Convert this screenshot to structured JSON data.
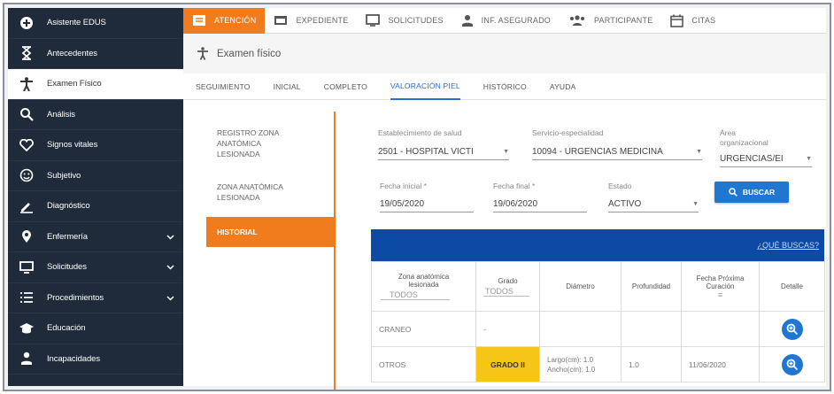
{
  "sidebar": {
    "items": [
      {
        "label": "Asistente EDUS",
        "icon": "plus-circle-icon"
      },
      {
        "label": "Antecedentes",
        "icon": "hourglass-icon"
      },
      {
        "label": "Examen Físico",
        "icon": "person-icon"
      },
      {
        "label": "Análisis",
        "icon": "magnify-icon"
      },
      {
        "label": "Signos vitales",
        "icon": "heart-icon"
      },
      {
        "label": "Subjetivo",
        "icon": "smiley-icon"
      },
      {
        "label": "Diagnóstico",
        "icon": "pencil-icon"
      },
      {
        "label": "Enfermería",
        "icon": "pin-icon"
      },
      {
        "label": "Solicitudes",
        "icon": "monitor-icon"
      },
      {
        "label": "Procedimientos",
        "icon": "list-icon"
      },
      {
        "label": "Educación",
        "icon": "graduation-cap-icon"
      },
      {
        "label": "Incapacidades",
        "icon": "user-icon"
      }
    ]
  },
  "topbar": {
    "tabs": [
      {
        "label": "ATENCIÓN"
      },
      {
        "label": "EXPEDIENTE"
      },
      {
        "label": "SOLICITUDES"
      },
      {
        "label": "INF. ASEGURADO"
      },
      {
        "label": "PARTICIPANTE"
      },
      {
        "label": "CITAS"
      }
    ]
  },
  "breadcrumb": {
    "title": "Examen físico"
  },
  "subtabs": [
    "SEGUIMIENTO",
    "INICIAL",
    "COMPLETO",
    "VALORACIÓN PIEL",
    "HISTÓRICO",
    "AYUDA"
  ],
  "leftmenu": {
    "items": [
      {
        "line1": "REGISTRO ZONA",
        "line2": "ANATÓMICA",
        "line3": "LESIONADA"
      },
      {
        "line1": "ZONA ANATÓMICA",
        "line2": "LESIONADA"
      },
      {
        "line1": "HISTORIAL"
      }
    ]
  },
  "filters": {
    "establecimiento": {
      "label": "Establecimiento de salud",
      "value": "2501 - HOSPITAL VICTI"
    },
    "servicio": {
      "label": "Servicio-especialidad",
      "value": "10094 - URGENCIAS MEDICINA"
    },
    "area": {
      "label1": "Área",
      "label2": "organizacional",
      "value": "URGENCIAS/EI"
    },
    "fecha_inicial": {
      "label": "Fecha inicial *",
      "value": "19/05/2020"
    },
    "fecha_final": {
      "label": "Fecha final *",
      "value": "19/06/2020"
    },
    "estado": {
      "label": "Estado",
      "value": "ACTIVO"
    },
    "buscar_label": "BUSCAR"
  },
  "table": {
    "help_link": "¿QUÉ BUSCAS?",
    "headers": {
      "zona": "Zona anatómica lesionada",
      "zona_filter": "TODOS",
      "grado": "Grado",
      "grado_filter": "TODOS",
      "diametro": "Diámetro",
      "profundidad": "Profundidad",
      "fecha": "Fecha Próxima Curación",
      "detalle": "Detalle"
    },
    "rows": [
      {
        "zona": "CRANEO",
        "grado": "-",
        "largo": "",
        "ancho": "",
        "profundidad": "",
        "fecha": ""
      },
      {
        "zona": "OTROS",
        "grado": "GRADO II",
        "largo": "Largo(cm): 1.0",
        "ancho": "Ancho(cm): 1.0",
        "profundidad": "1.0",
        "fecha": "11/06/2020"
      }
    ]
  },
  "colors": {
    "accent": "#f07c1e",
    "primary": "#1f77d0",
    "sidebar": "#1f2a3a",
    "grade": "#f5c518"
  }
}
